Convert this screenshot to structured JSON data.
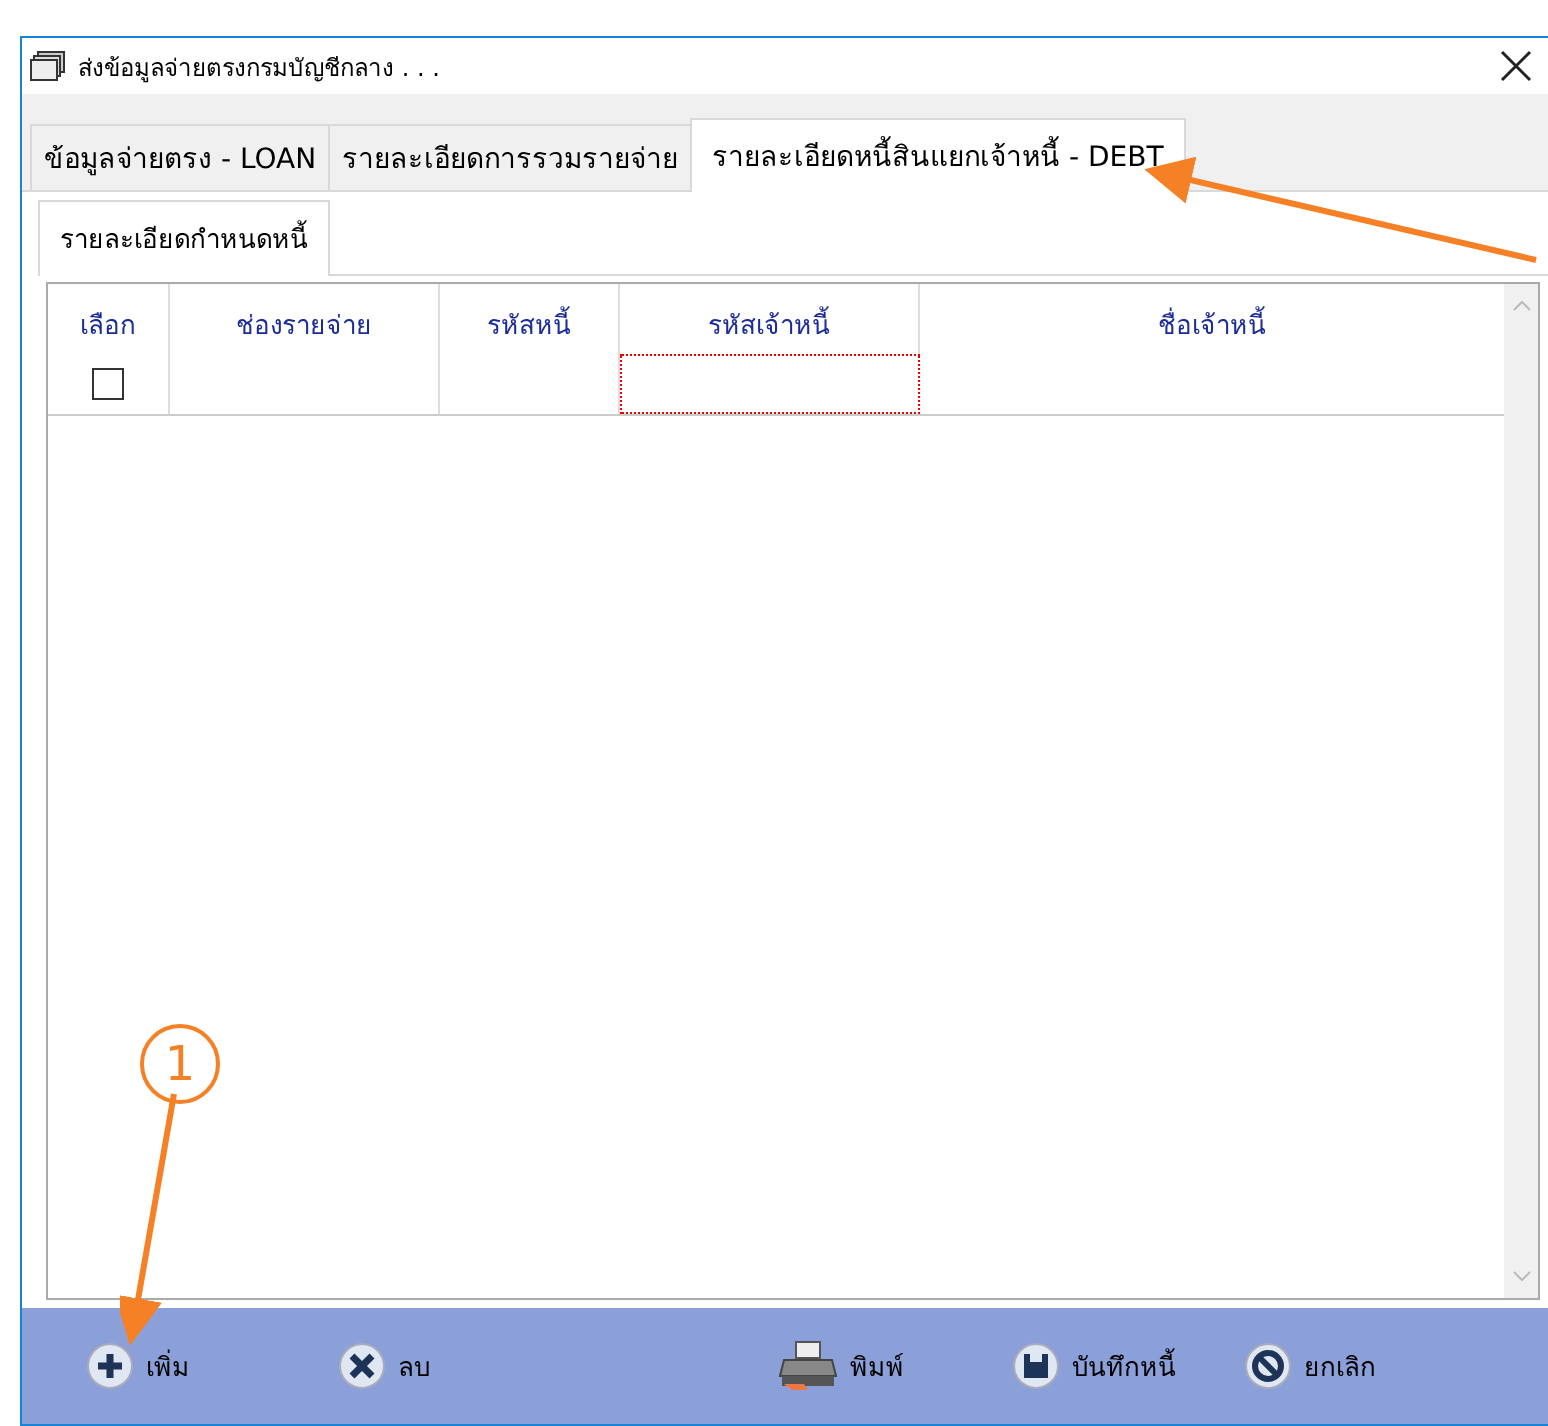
{
  "window": {
    "title": "ส่งข้อมูลจ่ายตรงกรมบัญชีกลาง . . ."
  },
  "tabs": [
    {
      "label": "ข้อมูลจ่ายตรง - LOAN",
      "selected": false
    },
    {
      "label": "รายละเอียดการรวมรายจ่าย",
      "selected": false
    },
    {
      "label": "รายละเอียดหนี้สินแยกเจ้าหนี้ - DEBT",
      "selected": true
    }
  ],
  "subtabs": [
    {
      "label": "รายละเอียดกำหนดหนี้",
      "selected": true
    }
  ],
  "table": {
    "columns": [
      "เลือก",
      "ช่องรายจ่าย",
      "รหัสหนี้",
      "รหัสเจ้าหนี้",
      "ชื่อเจ้าหนี้"
    ],
    "rows": [
      {
        "checked": false
      }
    ]
  },
  "toolbar": [
    {
      "kind": "add",
      "label": "เพิ่ม"
    },
    {
      "kind": "delete",
      "label": "ลบ"
    },
    {
      "kind": "print",
      "label": "พิมพ์"
    },
    {
      "kind": "save",
      "label": "บันทึกหนี้"
    },
    {
      "kind": "cancel",
      "label": "ยกเลิก"
    }
  ],
  "annotation": {
    "label": "1"
  }
}
